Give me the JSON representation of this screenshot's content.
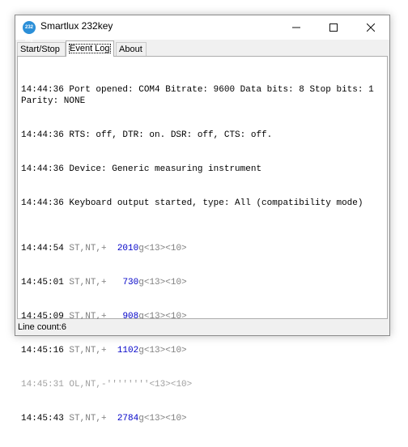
{
  "window": {
    "title": "Smartlux 232key",
    "icon_text": "232 key"
  },
  "tabs": [
    {
      "label": "Start/Stop"
    },
    {
      "label": "Event Log"
    },
    {
      "label": "About"
    }
  ],
  "log": {
    "info_lines": [
      "14:44:36 Port opened: COM4 Bitrate: 9600 Data bits: 8 Stop bits: 1 Parity: NONE",
      "14:44:36 RTS: off, DTR: on. DSR: off, CTS: off.",
      "14:44:36 Device: Generic measuring instrument",
      "14:44:36 Keyboard output started, type: All (compatibility mode)"
    ],
    "readings": [
      {
        "time": "14:44:54",
        "prefix": " ST,NT,+  ",
        "value": "2010",
        "unit": "g",
        "suffix": "<13><10>"
      },
      {
        "time": "14:45:01",
        "prefix": " ST,NT,+   ",
        "value": "730",
        "unit": "g",
        "suffix": "<13><10>"
      },
      {
        "time": "14:45:09",
        "prefix": " ST,NT,+   ",
        "value": "908",
        "unit": "g",
        "suffix": "<13><10>"
      },
      {
        "time": "14:45:16",
        "prefix": " ST,NT,+  ",
        "value": "1102",
        "unit": "g",
        "suffix": "<13><10>"
      },
      {
        "time": "14:45:31",
        "prefix": " OL,NT,-",
        "value": "''''''''",
        "unit": "",
        "suffix": "<13><10>",
        "muted": true
      },
      {
        "time": "14:45:43",
        "prefix": " ST,NT,+  ",
        "value": "2784",
        "unit": "g",
        "suffix": "<13><10>"
      }
    ]
  },
  "status": {
    "line_count": "Line count:6"
  }
}
